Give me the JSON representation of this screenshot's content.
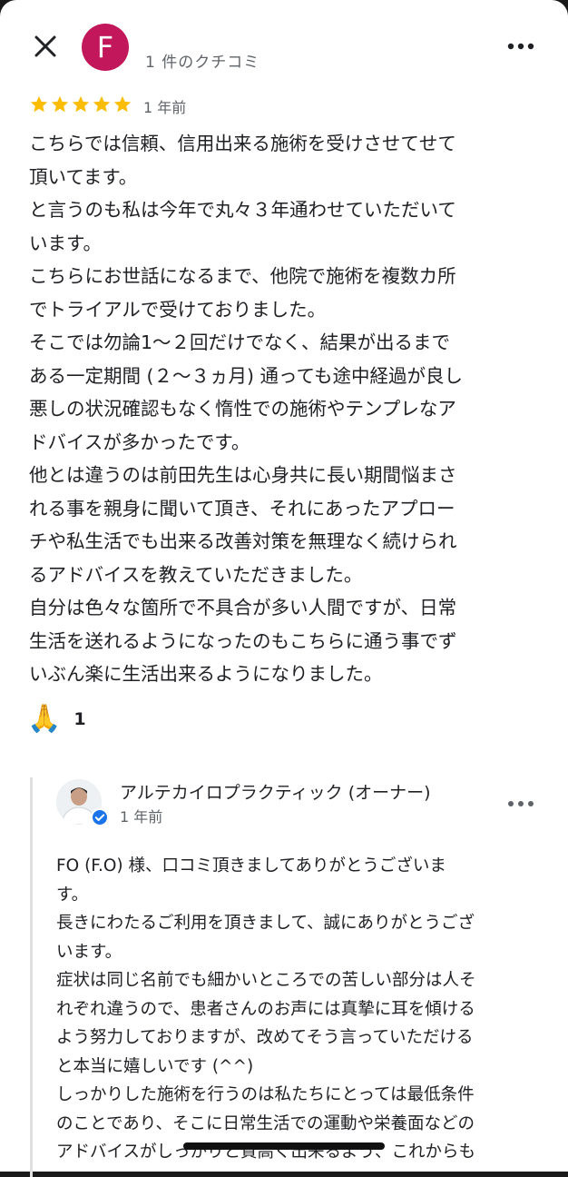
{
  "header": {
    "avatar_letter": "F",
    "avatar_color": "#c2185b",
    "review_count": "1 件のクチコミ",
    "close_icon": "close-icon",
    "more_icon": "more-horizontal-icon"
  },
  "review": {
    "rating": 5,
    "star_color": "#fbbc04",
    "date": "1 年前",
    "body": "こちらでは信頼、信用出来る施術を受けさせてせて\n頂いてます。\nと言うのも私は今年で丸々３年通わせていただいて\nいます。\nこちらにお世話になるまで、他院で施術を複数カ所\nでトライアルで受けておりました。\nそこでは勿論1〜２回だけでなく、結果が出るまで\nある一定期間 (２〜３ヵ月) 通っても途中経過が良し\n悪しの状況確認もなく惰性での施術やテンプレなア\nドバイスが多かったです。\n他とは違うのは前田先生は心身共に長い期間悩まさ\nれる事を親身に聞いて頂き、それにあったアプロー\nチや私生活でも出来る改善対策を無理なく続けられ\nるアドバイスを教えていただきました。\n自分は色々な箇所で不具合が多い人間ですが、日常\n生活を送れるようになったのもこちらに通う事でず\nいぶん楽に生活出来るようになりました。"
  },
  "reaction": {
    "emoji": "🙏",
    "count": "1"
  },
  "owner_reply": {
    "name": "アルテカイロプラクティック (オーナー)",
    "date": "1 年前",
    "verified_icon": "verified-badge-icon",
    "body": "FO (F.O) 様、口コミ頂きましてありがとうございま\nす。\n長きにわたるご利用を頂きまして、誠にありがとうござ\nいます。\n症状は同じ名前でも細かいところでの苦しい部分は人そ\nれぞれ違うので、患者さんのお声には真摯に耳を傾ける\nよう努力しておりますが、改めてそう言っていただける\nと本当に嬉しいです (^^)\nしっかりした施術を行うのは私たちにとっては最低条件\nのことであり、そこに日常生活での運動や栄養面などの\nアドバイスがしっかりと質高く出来るよう、これからも"
  }
}
